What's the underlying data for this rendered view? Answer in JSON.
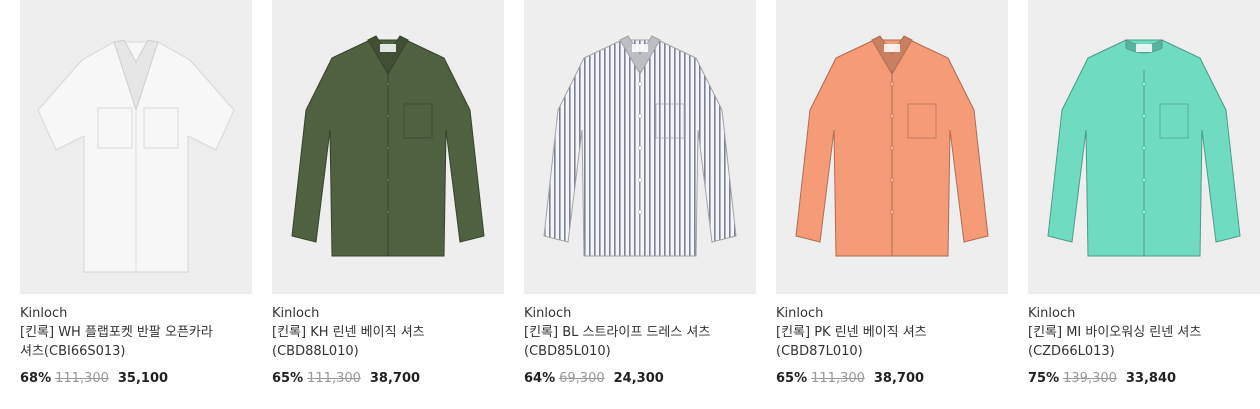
{
  "products": [
    {
      "brand": "Kinloch",
      "name_line1": "[킨록] WH 플랩포켓 반팔 오픈카라",
      "name_line2": "셔츠(CBI66S013)",
      "discount": "68%",
      "original_price": "111,300",
      "sale_price": "35,100",
      "shirt_color": "#f7f7f7",
      "image_icon": "short-sleeve-open-collar-shirt-icon"
    },
    {
      "brand": "Kinloch",
      "name_line1": "[킨록] KH 린넨 베이직 셔츠",
      "name_line2": "(CBD88L010)",
      "discount": "65%",
      "original_price": "111,300",
      "sale_price": "38,700",
      "shirt_color": "#4f6140",
      "image_icon": "long-sleeve-shirt-icon"
    },
    {
      "brand": "Kinloch",
      "name_line1": "[킨록] BL 스트라이프 드레스 셔츠",
      "name_line2": "(CBD85L010)",
      "discount": "64%",
      "original_price": "69,300",
      "sale_price": "24,300",
      "shirt_color": "#e7e8ee",
      "image_icon": "striped-dress-shirt-icon"
    },
    {
      "brand": "Kinloch",
      "name_line1": "[킨록] PK 린넨 베이직 셔츠",
      "name_line2": "(CBD87L010)",
      "discount": "65%",
      "original_price": "111,300",
      "sale_price": "38,700",
      "shirt_color": "#f59b78",
      "image_icon": "long-sleeve-shirt-icon"
    },
    {
      "brand": "Kinloch",
      "name_line1": "[킨록] MI 바이오워싱 린넨 셔츠",
      "name_line2": "(CZD66L013)",
      "discount": "75%",
      "original_price": "139,300",
      "sale_price": "33,840",
      "shirt_color": "#6fdcc2",
      "image_icon": "band-collar-shirt-icon"
    }
  ]
}
